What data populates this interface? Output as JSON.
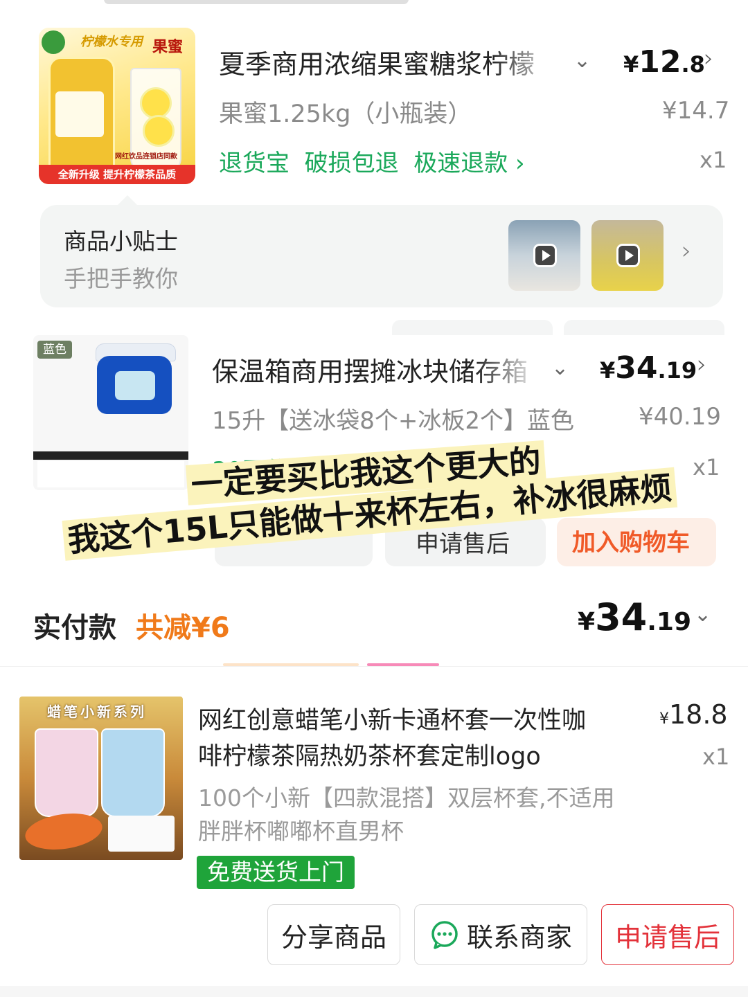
{
  "item1": {
    "title": "夏季商用浓缩果蜜糖浆柠檬",
    "price_symbol": "¥",
    "price_int": "12",
    "price_dec": ".8",
    "spec": "果蜜1.25kg（小瓶装）",
    "orig_price": "¥14.7",
    "services": "退货宝  破损包退  极速退款 ›",
    "qty": "x1",
    "image_tag1": "柠檬水专用",
    "image_tag2": "果蜜",
    "image_banner": "全新升级 提升柠檬茶品质",
    "image_small": "网红饮品连锁店同款"
  },
  "tips": {
    "title": "商品小贴士",
    "subtitle": "手把手教你"
  },
  "item2": {
    "title": "保温箱商用摆摊冰块储存箱",
    "price_symbol": "¥",
    "price_int": "34",
    "price_dec": ".19",
    "spec": "15升【送冰袋8个+冰板2个】蓝色",
    "orig_price": "¥40.19",
    "services": "30天价保  极速退款 ›",
    "qty": "x1",
    "color_tag": "蓝色",
    "buttons": {
      "after_sale": "申请售后",
      "add_cart": "加入购物车"
    }
  },
  "overlay": {
    "line1": "一定要买比我这个更大的",
    "line2": "我这个15L只能做十来杯左右，补冰很麻烦"
  },
  "payment": {
    "label": "实付款",
    "discount": "共减¥6",
    "price_symbol": "¥",
    "price_int": "34",
    "price_dec": ".19"
  },
  "item3": {
    "title": "网红创意蜡笔小新卡通杯套一次性咖啡柠檬茶隔热奶茶杯套定制logo",
    "title_line1": "网红创意蜡笔小新卡通杯套一次性咖",
    "title_line2": "啡柠檬茶隔热奶茶杯套定制logo",
    "price_symbol": "¥",
    "price": "18.8",
    "qty": "x1",
    "spec_line1": "100个小新【四款混搭】双层杯套,不适用",
    "spec_line2": "胖胖杯嘟嘟杯直男杯",
    "badge": "免费送货上门",
    "image_title": "蜡笔小新系列"
  },
  "actions": {
    "share": "分享商品",
    "contact": "联系商家",
    "after_sale": "申请售后"
  },
  "colors": {
    "green": "#1aa85a",
    "discount_orange": "#f07a1a",
    "red": "#e3323a",
    "highlight": "#fbf3bc"
  }
}
